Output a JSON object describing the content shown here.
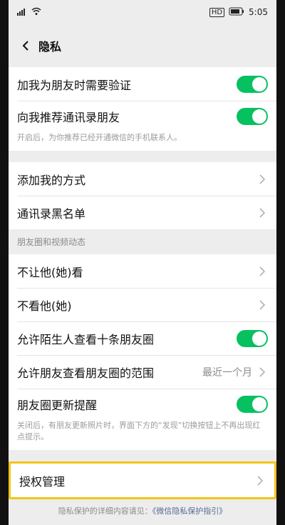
{
  "status": {
    "time": "5:05",
    "signal_icon": "signal-icon",
    "wifi_icon": "wifi-icon",
    "battery_icon": "battery-icon",
    "sim_label": "HD"
  },
  "nav": {
    "back_icon": "back-icon",
    "title": "隐私"
  },
  "group1": [
    {
      "label": "加我为朋友时需要验证",
      "toggle": true
    },
    {
      "label": "向我推荐通讯录朋友",
      "toggle": true,
      "sub": "开启后，为你推荐已经开通微信的手机联系人。"
    }
  ],
  "group2": [
    {
      "label": "添加我的方式"
    },
    {
      "label": "通讯录黑名单"
    }
  ],
  "section_header": "朋友圈和视频动态",
  "group3": [
    {
      "label": "不让他(她)看"
    },
    {
      "label": "不看他(她)"
    },
    {
      "label": "允许陌生人查看十条朋友圈",
      "toggle": true
    },
    {
      "label": "允许朋友查看朋友圈的范围",
      "value": "最近一个月"
    },
    {
      "label": "朋友圈更新提醒",
      "toggle": true,
      "sub": "关闭后，有朋友更新照片时，界面下方的“发现”切换按钮上不再出现红点提示。"
    }
  ],
  "group4": [
    {
      "label": "授权管理"
    }
  ],
  "footer": {
    "prefix": "隐私保护的详细内容请见：",
    "link": "《微信隐私保护指引》"
  },
  "colors": {
    "toggle_on": "#07c160",
    "highlight": "#f5c518",
    "link": "#576b95"
  }
}
